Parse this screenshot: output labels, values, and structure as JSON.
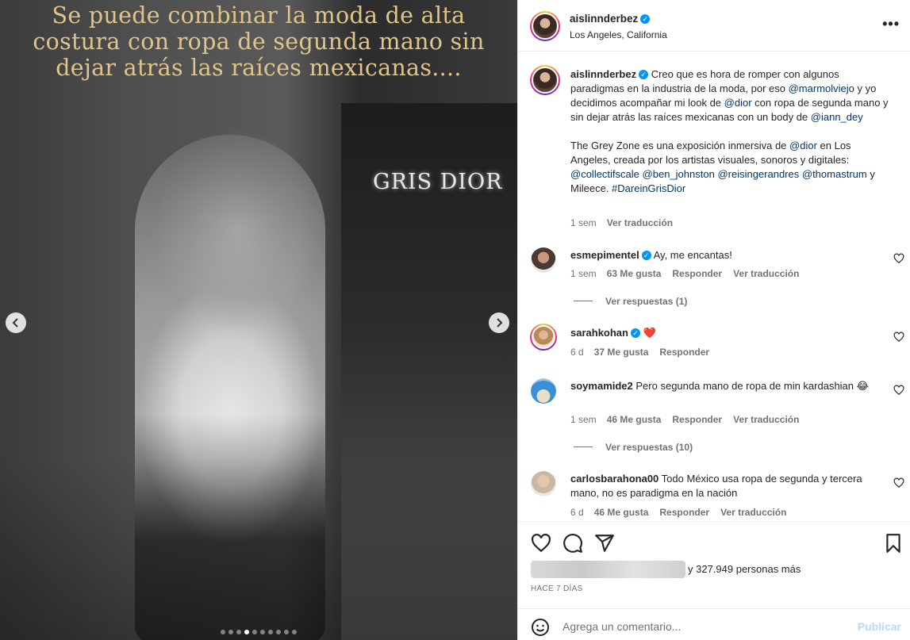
{
  "media": {
    "overlay_text": "Se puede combinar la moda de alta costura con ropa de segunda mano sin dejar atrás las raíces mexicanas....",
    "sign_text": "GRIS DIOR",
    "prev_icon": "chevron-left-icon",
    "next_icon": "chevron-right-icon",
    "carousel_dots": 10,
    "carousel_active_index": 3
  },
  "header": {
    "username": "aislinnderbez",
    "location": "Los Angeles, California",
    "more_icon": "more-icon"
  },
  "caption": {
    "username": "aislinnderbez",
    "p1_a": "Creo que es hora de romper con algunos paradigmas en la industria de la moda, por eso ",
    "m1": "@marmolviejo",
    "p1_b": " y yo decidimos acompañar mi look de ",
    "m2": "@dior",
    "p1_c": " con ropa de segunda mano y sin dejar atrás las raíces mexicanas con un body de ",
    "m3": "@iann_dey",
    "p2_a": "The Grey Zone es una exposición inmersiva de ",
    "m4": "@dior",
    "p2_b": " en Los Angeles, creada por los artistas visuales, sonoros y digitales: ",
    "m5": "@collectifscale",
    "m6": "@ben_johnston",
    "m7": "@reisingerandres",
    "m8": "@thomastrum",
    "p2_c": " y Mileece. ",
    "m9": "#DareinGrisDior",
    "time": "1 sem",
    "translate": "Ver traducción"
  },
  "comments": [
    {
      "username": "esmepimentel",
      "text": "Ay, me encantas!",
      "time": "1 sem",
      "likes": "63 Me gusta",
      "reply": "Responder",
      "translate": "Ver traducción",
      "view_replies": "Ver respuestas (1)"
    },
    {
      "username": "sarahkohan",
      "text": "❤️",
      "time": "6 d",
      "likes": "37 Me gusta",
      "reply": "Responder"
    },
    {
      "username": "soymamide2",
      "text": "Pero segunda mano de ropa de min kardashian 😂",
      "time": "1 sem",
      "likes": "46 Me gusta",
      "reply": "Responder",
      "translate": "Ver traducción",
      "view_replies": "Ver respuestas (10)"
    },
    {
      "username": "carlosbarahona00",
      "text": "Todo México usa ropa de segunda y tercera mano, no es paradigma en la nación",
      "time": "6 d",
      "likes": "46 Me gusta",
      "reply": "Responder",
      "translate": "Ver traducción"
    }
  ],
  "actions": {
    "like_icon": "heart-icon",
    "comment_icon": "comment-icon",
    "share_icon": "share-icon",
    "save_icon": "bookmark-icon"
  },
  "likes": {
    "text": "y 327.949 personas más"
  },
  "post_date": "HACE 7 DÍAS",
  "comment_bar": {
    "placeholder": "Agrega un comentario...",
    "publish_label": "Publicar",
    "emoji_icon": "emoji-icon"
  },
  "colors": {
    "verified": "#0095f6",
    "mention": "#00376b",
    "publish_disabled": "#b3dbff",
    "overlay_text": "#e0c58a"
  }
}
